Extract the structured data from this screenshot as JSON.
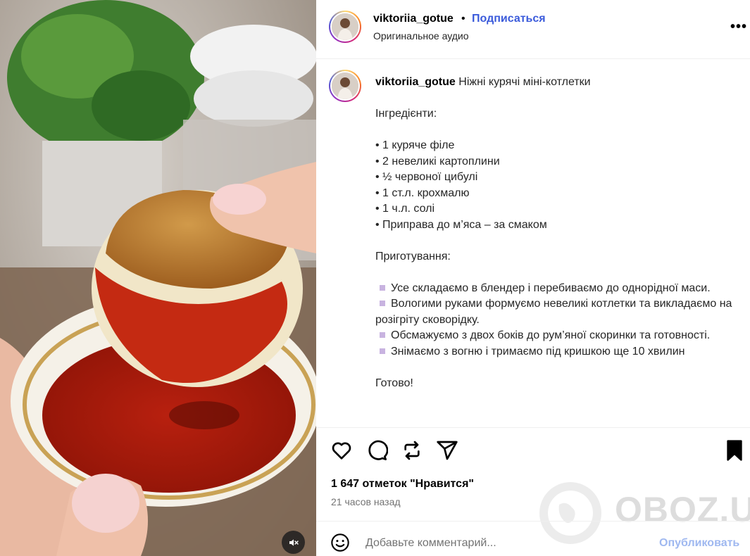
{
  "post": {
    "username": "viktoriia_gotue",
    "separator": "•",
    "follow_label": "Подписаться",
    "audio_label": "Оригинальное аудио",
    "more_label": "•••"
  },
  "caption": {
    "username": "viktoriia_gotue",
    "title": "Ніжні курячі міні-котлетки",
    "ingredients_heading": "Інгредієнти:",
    "ingredients": [
      "• 1 куряче філе",
      "• 2 невеликі картоплини",
      "• ½ червоної цибулі",
      "• 1 ст.л. крохмалю",
      "• 1 ч.л. солі",
      "• Приправа до м’яса – за смаком"
    ],
    "steps_heading": "Приготування:",
    "steps": [
      "Усе складаємо в блендер і перебиваємо до однорідної маси.",
      "Вологими руками формуємо невеликі котлетки та викладаємо на розігріту сковорідку.",
      "Обсмажуємо з двох боків до рум’яної скоринки та готовності.",
      "Знімаємо з вогню і тримаємо під кришкою ще 10 хвилин"
    ],
    "closing": "Готово!"
  },
  "stats": {
    "likes": "1 647 отметок \"Нравится\"",
    "time_ago": "21 часов назад"
  },
  "comment": {
    "placeholder": "Добавьте комментарий...",
    "publish_label": "Опубликовать"
  },
  "watermark": {
    "text": "OBOZ.UA"
  },
  "icons": {
    "like": "heart-icon",
    "comment": "comment-icon",
    "repost": "repost-icon",
    "share": "send-icon",
    "save": "bookmark-icon",
    "mute": "speaker-muted-icon",
    "emoji": "emoji-icon"
  },
  "colors": {
    "follow_blue": "#3b5bdb",
    "publish_disabled": "#9fb8f0",
    "bullet_diamond": "#c8b3e0"
  }
}
